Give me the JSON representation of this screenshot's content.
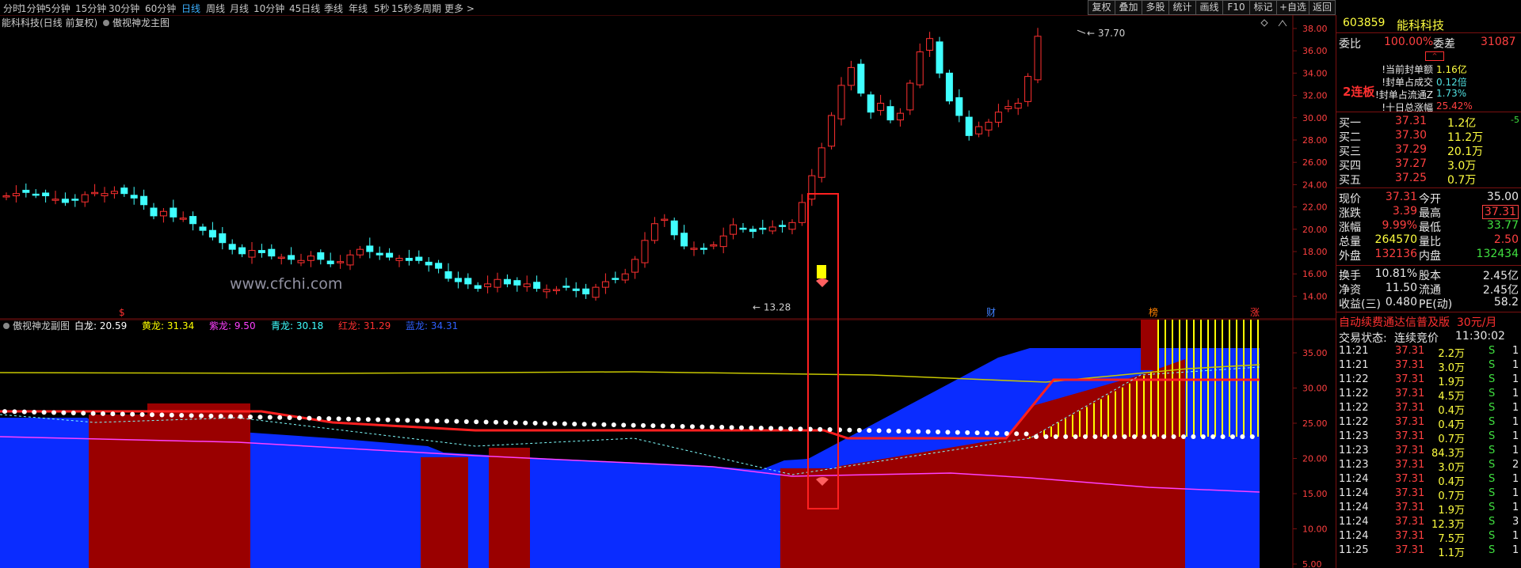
{
  "toolbar": {
    "periods": [
      "分时",
      "1分钟",
      "5分钟",
      "15分钟",
      "30分钟",
      "60分钟",
      "日线",
      "周线",
      "月线",
      "10分钟",
      "45日线",
      "季线",
      "年线",
      "5秒",
      "15秒",
      "多周期",
      "更多 >"
    ],
    "active": "日线",
    "right_buttons": [
      "复权",
      "叠加",
      "多股",
      "统计",
      "画线",
      "F10",
      "标记",
      "+自选",
      "返回"
    ]
  },
  "main_chart": {
    "title": "能科科技(日线 前复权)",
    "indicator": "傲视神龙主图",
    "high_label": "37.70",
    "low_label": "13.28",
    "watermark": "www.cfchi.com",
    "y_ticks": [
      "38.00",
      "36.00",
      "34.00",
      "32.00",
      "30.00",
      "28.00",
      "26.00",
      "24.00",
      "22.00",
      "20.00",
      "18.00",
      "16.00",
      "14.00"
    ],
    "event_marks": [
      "$",
      "财",
      "榜",
      "涨"
    ]
  },
  "sub_chart": {
    "title": "傲视神龙副图",
    "legend": [
      {
        "label": "白龙:",
        "value": "20.59",
        "color": "#ffffff"
      },
      {
        "label": "黄龙:",
        "value": "31.34",
        "color": "#ffff00"
      },
      {
        "label": "紫龙:",
        "value": "9.50",
        "color": "#ff40ff"
      },
      {
        "label": "青龙:",
        "value": "30.18",
        "color": "#40ffff"
      },
      {
        "label": "红龙:",
        "value": "31.29",
        "color": "#ff3030"
      },
      {
        "label": "蓝龙:",
        "value": "34.31",
        "color": "#3060ff"
      }
    ],
    "y_ticks": [
      "35.00",
      "30.00",
      "25.00",
      "20.00",
      "15.00",
      "10.00",
      "5.00"
    ]
  },
  "stock": {
    "code": "603859",
    "name": "能科科技",
    "weibi_label": "委比",
    "weibi": "100.00%",
    "weicha_label": "委差",
    "weicha": "31087",
    "lianban": "2连板",
    "seal": [
      {
        "label": "当前封单额",
        "value": "1.16亿"
      },
      {
        "label": "封单占成交",
        "value": "0.12倍"
      },
      {
        "label": "封单占流通Z",
        "value": "1.73%"
      },
      {
        "label": "十日总涨幅",
        "value": "25.42%"
      }
    ],
    "bids": [
      {
        "label": "买一",
        "price": "37.31",
        "vol": "1.2亿",
        "chg": "-5"
      },
      {
        "label": "买二",
        "price": "37.30",
        "vol": "11.2万",
        "chg": ""
      },
      {
        "label": "买三",
        "price": "37.29",
        "vol": "20.1万",
        "chg": ""
      },
      {
        "label": "买四",
        "price": "37.27",
        "vol": "3.0万",
        "chg": ""
      },
      {
        "label": "买五",
        "price": "37.25",
        "vol": "0.7万",
        "chg": ""
      }
    ],
    "quote": [
      {
        "l1": "现价",
        "v1": "37.31",
        "l2": "今开",
        "v2": "35.00"
      },
      {
        "l1": "涨跌",
        "v1": "3.39",
        "l2": "最高",
        "v2": "37.31"
      },
      {
        "l1": "涨幅",
        "v1": "9.99%",
        "l2": "最低",
        "v2": "33.77"
      },
      {
        "l1": "总量",
        "v1": "264570",
        "l2": "量比",
        "v2": "2.50"
      },
      {
        "l1": "外盘",
        "v1": "132136",
        "l2": "内盘",
        "v2": "132434"
      }
    ],
    "fund": [
      {
        "l1": "换手",
        "v1": "10.81%",
        "l2": "股本",
        "v2": "2.45亿"
      },
      {
        "l1": "净资",
        "v1": "11.50",
        "l2": "流通",
        "v2": "2.45亿"
      },
      {
        "l1": "收益(三)",
        "v1": "0.480",
        "l2": "PE(动)",
        "v2": "58.2"
      }
    ],
    "ad": "自动续费通达信普及版  30元/月",
    "trade_status_label": "交易状态:",
    "trade_status": "连续竞价",
    "trade_time": "11:30:02",
    "ticks": [
      {
        "t": "11:21",
        "p": "37.31",
        "v": "2.2万",
        "s": "S",
        "n": "1"
      },
      {
        "t": "11:21",
        "p": "37.31",
        "v": "3.0万",
        "s": "S",
        "n": "1"
      },
      {
        "t": "11:22",
        "p": "37.31",
        "v": "1.9万",
        "s": "S",
        "n": "1"
      },
      {
        "t": "11:22",
        "p": "37.31",
        "v": "4.5万",
        "s": "S",
        "n": "1"
      },
      {
        "t": "11:22",
        "p": "37.31",
        "v": "0.4万",
        "s": "S",
        "n": "1"
      },
      {
        "t": "11:22",
        "p": "37.31",
        "v": "0.4万",
        "s": "S",
        "n": "1"
      },
      {
        "t": "11:23",
        "p": "37.31",
        "v": "0.7万",
        "s": "S",
        "n": "1"
      },
      {
        "t": "11:23",
        "p": "37.31",
        "v": "84.3万",
        "s": "S",
        "n": "1"
      },
      {
        "t": "11:23",
        "p": "37.31",
        "v": "3.0万",
        "s": "S",
        "n": "2"
      },
      {
        "t": "11:24",
        "p": "37.31",
        "v": "0.4万",
        "s": "S",
        "n": "1"
      },
      {
        "t": "11:24",
        "p": "37.31",
        "v": "0.7万",
        "s": "S",
        "n": "1"
      },
      {
        "t": "11:24",
        "p": "37.31",
        "v": "1.9万",
        "s": "S",
        "n": "1"
      },
      {
        "t": "11:24",
        "p": "37.31",
        "v": "12.3万",
        "s": "S",
        "n": "3"
      },
      {
        "t": "11:24",
        "p": "37.31",
        "v": "7.5万",
        "s": "S",
        "n": "1"
      },
      {
        "t": "11:25",
        "p": "37.31",
        "v": "1.1万",
        "s": "S",
        "n": "1"
      }
    ]
  },
  "colors": {
    "up": "#ff3030",
    "down": "#40ffff",
    "border": "#7a1010"
  }
}
